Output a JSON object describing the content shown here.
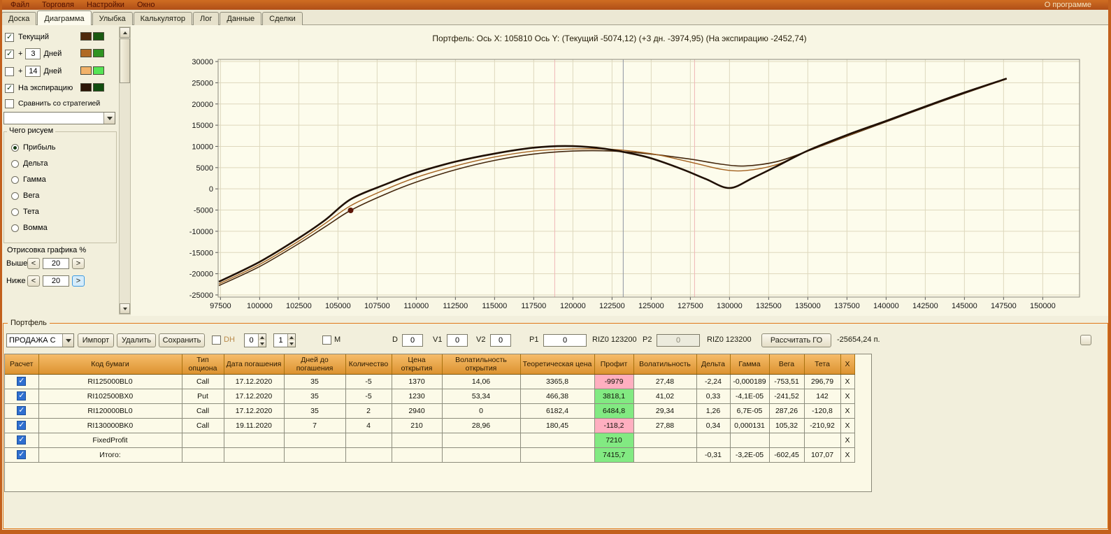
{
  "menu": {
    "items": [
      "Файл",
      "Торговля",
      "Настройки",
      "Окно"
    ],
    "about": "О программе"
  },
  "tabs": {
    "items": [
      "Доска",
      "Диаграмма",
      "Улыбка",
      "Калькулятор",
      "Лог",
      "Данные",
      "Сделки"
    ],
    "active": "Диаграмма"
  },
  "panel": {
    "lines": [
      {
        "label": "Текущий",
        "checked": true,
        "has_input": false,
        "swatch1": "#4f2a0c",
        "swatch2": "#1a5a12"
      },
      {
        "label": "Дней",
        "plus": "+",
        "days": "3",
        "checked": true,
        "has_input": true,
        "swatch1": "#b06a24",
        "swatch2": "#2f9422"
      },
      {
        "label": "Дней",
        "plus": "+",
        "days": "14",
        "checked": false,
        "has_input": true,
        "swatch1": "#f2b269",
        "swatch2": "#55e455"
      },
      {
        "label": "На экспирацию",
        "checked": true,
        "has_input": false,
        "swatch1": "#2c1506",
        "swatch2": "#114e10"
      }
    ],
    "compare": {
      "label": "Сравнить со стратегией",
      "checked": false
    },
    "draw": {
      "title": "Чего рисуем",
      "options": [
        "Прибыль",
        "Дельта",
        "Гамма",
        "Вега",
        "Тета",
        "Вомма"
      ],
      "selected": "Прибыль"
    },
    "render": {
      "title": "Отрисовка графика %",
      "rows": [
        {
          "label": "Выше",
          "value": "20",
          "hl": false
        },
        {
          "label": "Ниже",
          "value": "20",
          "hl": true
        }
      ]
    }
  },
  "chart_data": {
    "type": "line",
    "title": "Портфель: Ось X: 105810 Ось Y:  (Текущий -5074,12)  (+3 дн. -3974,95)  (На экспирацию -2452,74)",
    "axis": {
      "x_min": 97500,
      "x_max": 150000,
      "x_step": 2500,
      "y_min": -25000,
      "y_max": 30000,
      "y_step": 5000,
      "xlim": [
        97350,
        152350
      ],
      "ylim": [
        -25500,
        30500
      ]
    },
    "vlines": [
      {
        "x": 118840,
        "color": "#efb6b6"
      },
      {
        "x": 123214,
        "color": "#8d94a0"
      },
      {
        "x": 127770,
        "color": "#efb6b6"
      }
    ],
    "marker": {
      "x": 105810,
      "y": -5074,
      "color": "#5c1608"
    },
    "series": [
      {
        "name": "Текущий",
        "color": "#45280e",
        "width": 1.6,
        "points": [
          [
            97400,
            -22800
          ],
          [
            100000,
            -18300
          ],
          [
            102500,
            -12900
          ],
          [
            104200,
            -8900
          ],
          [
            105810,
            -5074
          ],
          [
            108000,
            -1300
          ],
          [
            110000,
            1600
          ],
          [
            112500,
            4500
          ],
          [
            115000,
            6700
          ],
          [
            117500,
            8200
          ],
          [
            120000,
            8900
          ],
          [
            122500,
            8900
          ],
          [
            125000,
            8200
          ],
          [
            127500,
            7000
          ],
          [
            129500,
            5800
          ],
          [
            131000,
            5400
          ],
          [
            133000,
            6400
          ],
          [
            135000,
            8900
          ],
          [
            137500,
            12400
          ],
          [
            140000,
            15800
          ],
          [
            142500,
            19200
          ],
          [
            145000,
            22500
          ],
          [
            147700,
            25900
          ]
        ]
      },
      {
        "name": "+3 дн",
        "color": "#a3611f",
        "width": 1.4,
        "points": [
          [
            97400,
            -22400
          ],
          [
            100000,
            -17800
          ],
          [
            102500,
            -12300
          ],
          [
            104200,
            -8100
          ],
          [
            105810,
            -3975
          ],
          [
            108000,
            -200
          ],
          [
            110000,
            2700
          ],
          [
            112500,
            5400
          ],
          [
            115000,
            7500
          ],
          [
            117500,
            8900
          ],
          [
            120000,
            9400
          ],
          [
            122500,
            9300
          ],
          [
            125000,
            8300
          ],
          [
            127500,
            6300
          ],
          [
            129500,
            4600
          ],
          [
            131000,
            4300
          ],
          [
            133000,
            5700
          ],
          [
            135000,
            8900
          ],
          [
            137500,
            12500
          ],
          [
            140000,
            15900
          ],
          [
            142500,
            19300
          ],
          [
            145000,
            22600
          ],
          [
            147700,
            25900
          ]
        ]
      },
      {
        "name": "На экспирацию",
        "color": "#201004",
        "width": 2.6,
        "points": [
          [
            97400,
            -21900
          ],
          [
            100000,
            -17200
          ],
          [
            102500,
            -11600
          ],
          [
            104200,
            -7300
          ],
          [
            105810,
            -2453
          ],
          [
            108000,
            1000
          ],
          [
            110000,
            3800
          ],
          [
            112500,
            6400
          ],
          [
            115000,
            8300
          ],
          [
            117500,
            9700
          ],
          [
            119500,
            10100
          ],
          [
            121500,
            9700
          ],
          [
            123500,
            8500
          ],
          [
            125000,
            7200
          ],
          [
            127000,
            4600
          ],
          [
            128500,
            2300
          ],
          [
            130000,
            200
          ],
          [
            131500,
            2600
          ],
          [
            133000,
            5300
          ],
          [
            135000,
            9000
          ],
          [
            137500,
            12700
          ],
          [
            140000,
            16000
          ],
          [
            142500,
            19400
          ],
          [
            145000,
            22700
          ],
          [
            147700,
            26000
          ]
        ]
      }
    ]
  },
  "portfolio": {
    "title": "Портфель",
    "combo": "ПРОДАЖА С",
    "btn_import": "Импорт",
    "btn_delete": "Удалить",
    "btn_save": "Сохранить",
    "dh": "DH",
    "dh_v1": "0",
    "dh_v2": "1",
    "m": "M",
    "d_label": "D",
    "d": "0",
    "v1_label": "V1",
    "v1": "0",
    "v2_label": "V2",
    "v2": "0",
    "p1_label": "P1",
    "p1": "0",
    "riz1": "RIZ0 123200",
    "p2_label": "P2",
    "p2": "0",
    "riz2": "RIZ0 123200",
    "btn_calc": "Рассчитать ГО",
    "go": "-25654,24 п."
  },
  "table": {
    "headers": [
      "Расчет",
      "Код бумаги",
      "Тип опциона",
      "Дата погашения",
      "Дней до погашения",
      "Количество",
      "Цена открытия",
      "Волатильность открытия",
      "Теоретическая цена",
      "Профит",
      "Волатильность",
      "Дельта",
      "Гамма",
      "Вега",
      "Тета",
      "X"
    ],
    "x_label": "X",
    "rows": [
      {
        "checked": true,
        "profit_tone": "neg",
        "cells": [
          "RI125000BL0",
          "Call",
          "17.12.2020",
          "35",
          "-5",
          "1370",
          "14,06",
          "3365,8",
          "-9979",
          "27,48",
          "-2,24",
          "-0,000189",
          "-753,51",
          "296,79"
        ]
      },
      {
        "checked": true,
        "profit_tone": "pos",
        "cells": [
          "RI102500BX0",
          "Put",
          "17.12.2020",
          "35",
          "-5",
          "1230",
          "53,34",
          "466,38",
          "3818,1",
          "41,02",
          "0,33",
          "-4,1E-05",
          "-241,52",
          "142"
        ]
      },
      {
        "checked": true,
        "profit_tone": "pos",
        "cells": [
          "RI120000BL0",
          "Call",
          "17.12.2020",
          "35",
          "2",
          "2940",
          "0",
          "6182,4",
          "6484,8",
          "29,34",
          "1,26",
          "6,7E-05",
          "287,26",
          "-120,8"
        ]
      },
      {
        "checked": true,
        "profit_tone": "neg",
        "cells": [
          "RI130000BK0",
          "Call",
          "19.11.2020",
          "7",
          "4",
          "210",
          "28,96",
          "180,45",
          "-118,2",
          "27,88",
          "0,34",
          "0,000131",
          "105,32",
          "-210,92"
        ]
      },
      {
        "checked": true,
        "profit_tone": "pos",
        "cells": [
          "FixedProfit",
          "",
          "",
          "",
          "",
          "",
          "",
          "",
          "7210",
          "",
          "",
          "",
          "",
          ""
        ]
      },
      {
        "checked": true,
        "profit_tone": "pos",
        "cells": [
          "Итого:",
          "",
          "",
          "",
          "",
          "",
          "",
          "",
          "7415,7",
          "",
          "-0,31",
          "-3,2E-05",
          "-602,45",
          "107,07"
        ]
      }
    ]
  }
}
